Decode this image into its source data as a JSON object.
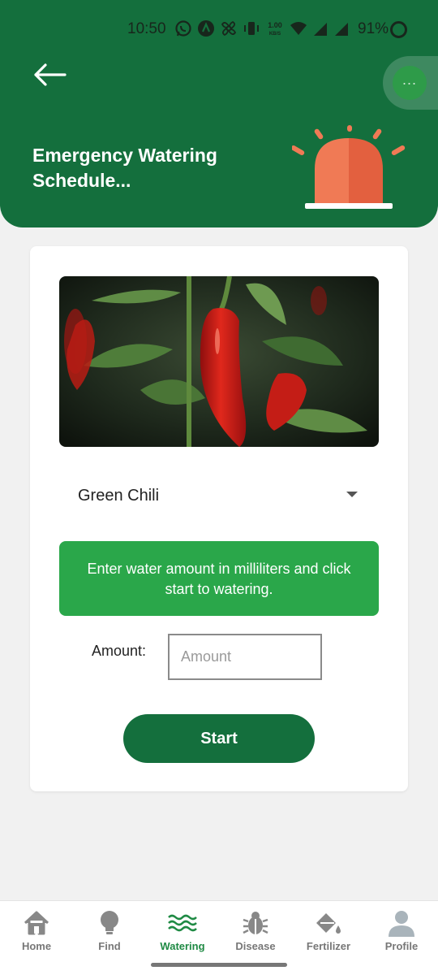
{
  "status_bar": {
    "time": "10:50",
    "net_speed_top": "1.00",
    "net_speed_bottom": "KB/S",
    "battery": "91%",
    "icons": [
      "whatsapp-icon",
      "app-icon",
      "fan-icon",
      "vibrate-icon",
      "wifi-icon",
      "signal-icon",
      "signal-icon",
      "battery-icon"
    ]
  },
  "header": {
    "title": "Emergency Watering Schedule...",
    "back_icon": "arrow-left-icon",
    "alarm_icon": "alarm-siren-icon",
    "accent_color": "#146f3d"
  },
  "floating_bubble": {
    "label": "..."
  },
  "card": {
    "image_subject": "red-chili-plant",
    "selected_plant": "Green Chili",
    "info_text": "Enter water amount in milliliters and click start to watering.",
    "amount_label": "Amount:",
    "amount_value": "",
    "amount_placeholder": "Amount",
    "start_label": "Start",
    "info_color": "#2aa74a"
  },
  "bottom_nav": {
    "active": "Watering",
    "items": [
      {
        "label": "Home",
        "icon": "home-icon"
      },
      {
        "label": "Find",
        "icon": "lightbulb-icon"
      },
      {
        "label": "Watering",
        "icon": "water-waves-icon"
      },
      {
        "label": "Disease",
        "icon": "bug-icon"
      },
      {
        "label": "Fertilizer",
        "icon": "paint-bucket-icon"
      },
      {
        "label": "Profile",
        "icon": "person-icon"
      }
    ]
  }
}
